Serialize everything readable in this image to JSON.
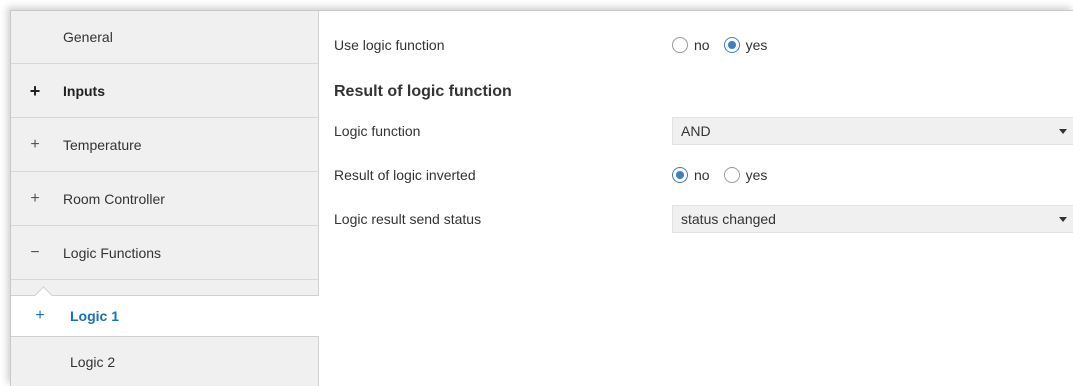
{
  "sidebar": {
    "items": [
      {
        "label": "General",
        "toggle": ""
      },
      {
        "label": "Inputs",
        "toggle": "+"
      },
      {
        "label": "Temperature",
        "toggle": "+"
      },
      {
        "label": "Room Controller",
        "toggle": "+"
      },
      {
        "label": "Logic Functions",
        "toggle": "−"
      },
      {
        "label": "Logic 1",
        "toggle": "+"
      },
      {
        "label": "Logic 2",
        "toggle": ""
      }
    ]
  },
  "main": {
    "use_logic": {
      "label": "Use logic function",
      "options": [
        "no",
        "yes"
      ],
      "selected": "yes"
    },
    "section_title": "Result of logic function",
    "logic_function": {
      "label": "Logic function",
      "value": "AND"
    },
    "result_inverted": {
      "label": "Result of logic inverted",
      "options": [
        "no",
        "yes"
      ],
      "selected": "no"
    },
    "send_status": {
      "label": "Logic result send status",
      "value": "status changed"
    }
  },
  "colors": {
    "accent": "#3c7fc4",
    "active_text": "#1a6fb5",
    "sidebar_bg": "#f0f0f0"
  }
}
